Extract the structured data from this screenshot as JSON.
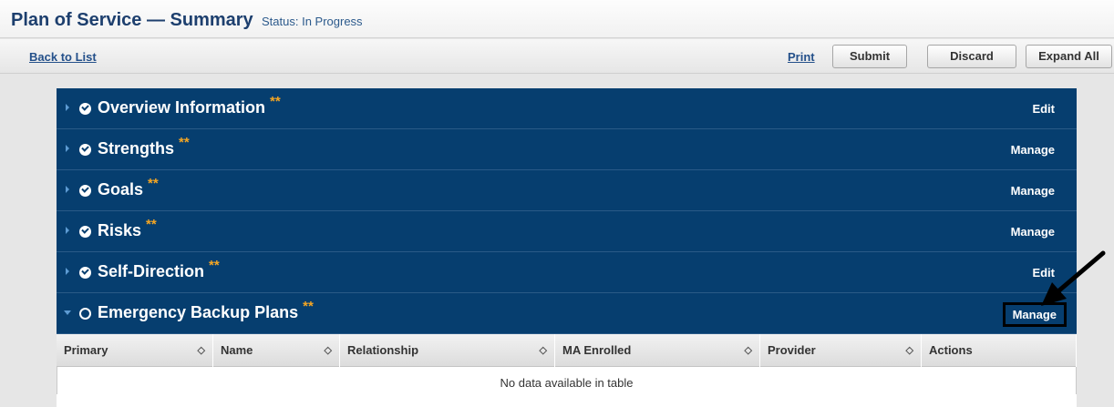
{
  "header": {
    "title": "Plan of Service — Summary",
    "status": "Status: In Progress"
  },
  "toolbar": {
    "back_label": "Back to List",
    "print_label": "Print",
    "submit_label": "Submit",
    "discard_label": "Discard",
    "expand_label": "Expand All"
  },
  "sections": [
    {
      "title": "Overview Information",
      "stars": "**",
      "action": "Edit",
      "status_icon": "check-circle-icon",
      "expanded": false
    },
    {
      "title": "Strengths",
      "stars": "**",
      "action": "Manage",
      "status_icon": "check-circle-icon",
      "expanded": false
    },
    {
      "title": "Goals",
      "stars": "**",
      "action": "Manage",
      "status_icon": "check-circle-icon",
      "expanded": false
    },
    {
      "title": "Risks",
      "stars": "**",
      "action": "Manage",
      "status_icon": "check-circle-icon",
      "expanded": false
    },
    {
      "title": "Self-Direction",
      "stars": "**",
      "action": "Edit",
      "status_icon": "check-circle-icon",
      "expanded": false
    },
    {
      "title": "Emergency Backup Plans",
      "stars": "**",
      "action": "Manage",
      "status_icon": "empty-circle-icon",
      "expanded": true
    }
  ],
  "table": {
    "columns": [
      "Primary",
      "Name",
      "Relationship",
      "MA Enrolled",
      "Provider",
      "Actions"
    ],
    "empty_message": "No data available in table"
  },
  "colors": {
    "section_bg": "#063e6f",
    "star": "#f5a623",
    "link": "#24508a"
  }
}
